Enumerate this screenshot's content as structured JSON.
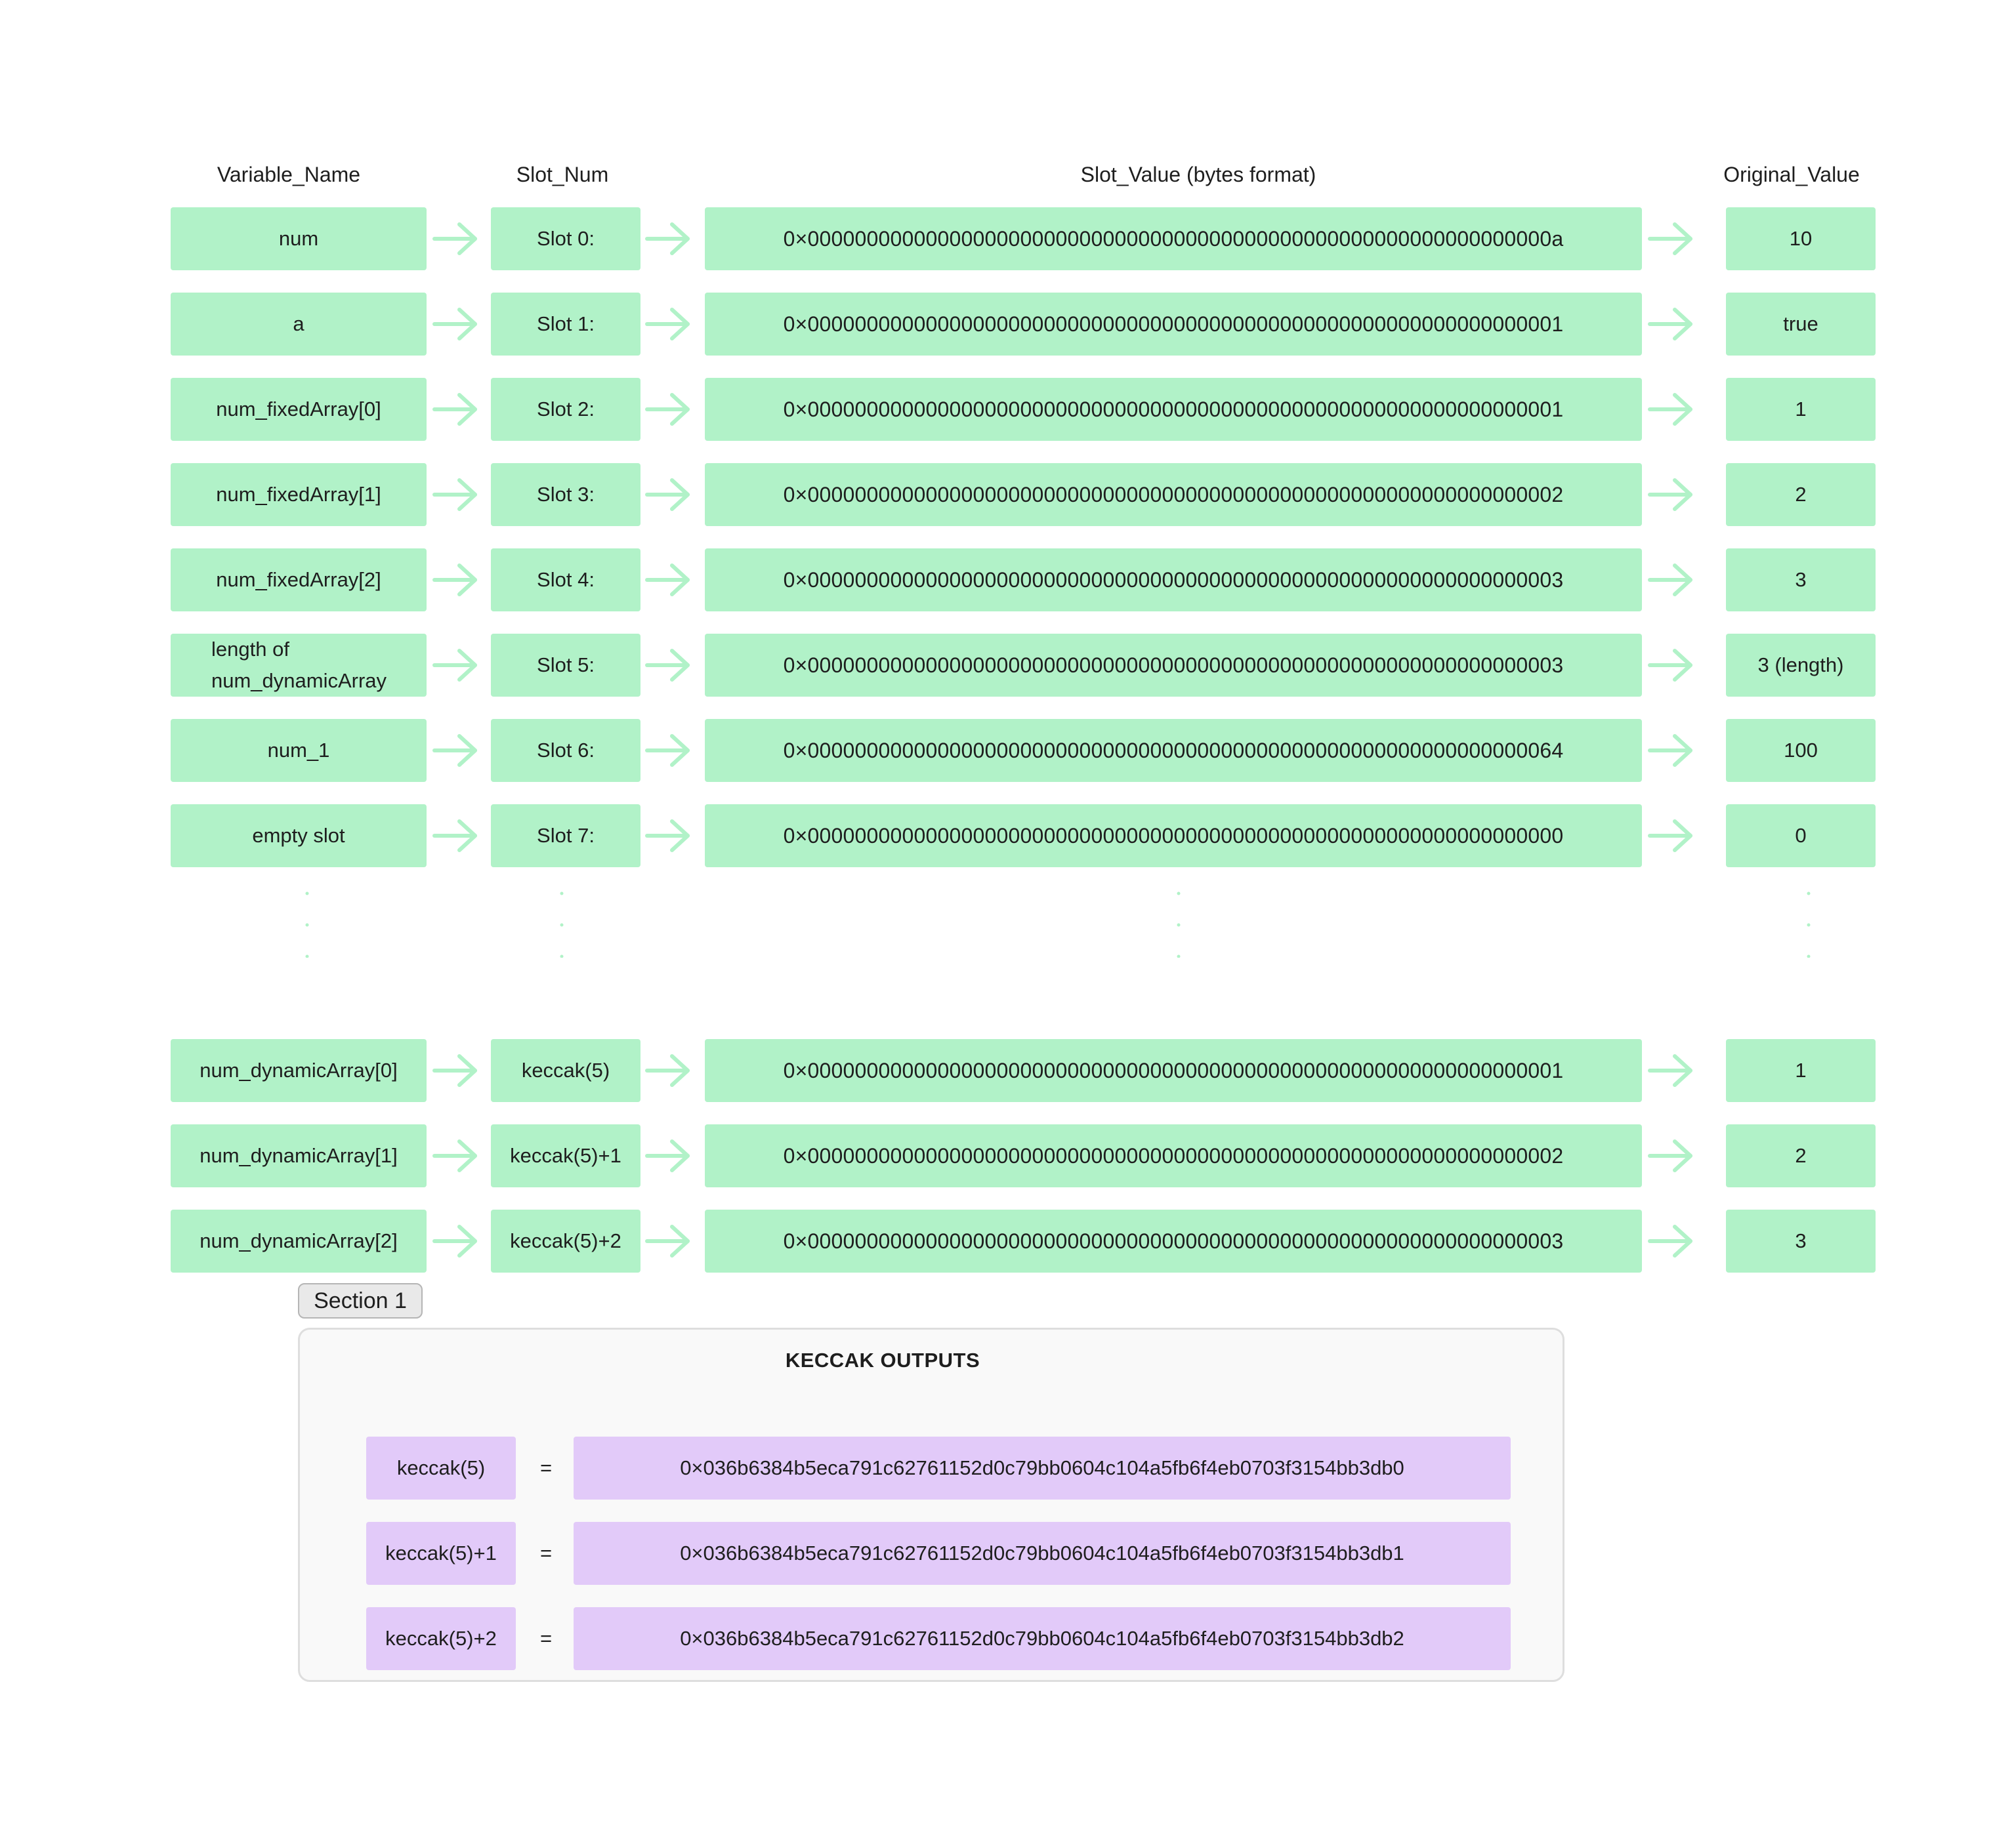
{
  "headers": {
    "variable": "Variable_Name",
    "slot": "Slot_Num",
    "value": "Slot_Value (bytes format)",
    "original": "Original_Value"
  },
  "rows": [
    {
      "variable": "num",
      "slot": "Slot 0:",
      "value": "0×000000000000000000000000000000000000000000000000000000000000000a",
      "original": "10"
    },
    {
      "variable": "a",
      "slot": "Slot 1:",
      "value": "0×0000000000000000000000000000000000000000000000000000000000000001",
      "original": "true"
    },
    {
      "variable": "num_fixedArray[0]",
      "slot": "Slot 2:",
      "value": "0×0000000000000000000000000000000000000000000000000000000000000001",
      "original": "1"
    },
    {
      "variable": "num_fixedArray[1]",
      "slot": "Slot 3:",
      "value": "0×0000000000000000000000000000000000000000000000000000000000000002",
      "original": "2"
    },
    {
      "variable": "num_fixedArray[2]",
      "slot": "Slot 4:",
      "value": "0×0000000000000000000000000000000000000000000000000000000000000003",
      "original": "3"
    },
    {
      "variable": "length of num_dynamicArray",
      "slot": "Slot 5:",
      "value": "0×0000000000000000000000000000000000000000000000000000000000000003",
      "original": "3 (length)"
    },
    {
      "variable": "num_1",
      "slot": "Slot 6:",
      "value": "0×0000000000000000000000000000000000000000000000000000000000000064",
      "original": "100"
    },
    {
      "variable": "empty slot",
      "slot": "Slot 7:",
      "value": "0×0000000000000000000000000000000000000000000000000000000000000000",
      "original": "0"
    },
    {
      "variable": "num_dynamicArray[0]",
      "slot": "keccak(5)",
      "value": "0×0000000000000000000000000000000000000000000000000000000000000001",
      "original": "1"
    },
    {
      "variable": "num_dynamicArray[1]",
      "slot": "keccak(5)+1",
      "value": "0×0000000000000000000000000000000000000000000000000000000000000002",
      "original": "2"
    },
    {
      "variable": "num_dynamicArray[2]",
      "slot": "keccak(5)+2",
      "value": "0×0000000000000000000000000000000000000000000000000000000000000003",
      "original": "3"
    }
  ],
  "section": {
    "tab_label": "Section 1",
    "title": "KECCAK OUTPUTS",
    "equals": "=",
    "outputs": [
      {
        "label": "keccak(5)",
        "value": "0×036b6384b5eca791c62761152d0c79bb0604c104a5fb6f4eb0703f3154bb3db0"
      },
      {
        "label": "keccak(5)+1",
        "value": "0×036b6384b5eca791c62761152d0c79bb0604c104a5fb6f4eb0703f3154bb3db1"
      },
      {
        "label": "keccak(5)+2",
        "value": "0×036b6384b5eca791c62761152d0c79bb0604c104a5fb6f4eb0703f3154bb3db2"
      }
    ]
  },
  "colors": {
    "row_box": "#b1f2c8",
    "arrow": "#b1f2c8",
    "keccak_box": "#e2caf9",
    "panel_bg": "#f9f9f9"
  }
}
